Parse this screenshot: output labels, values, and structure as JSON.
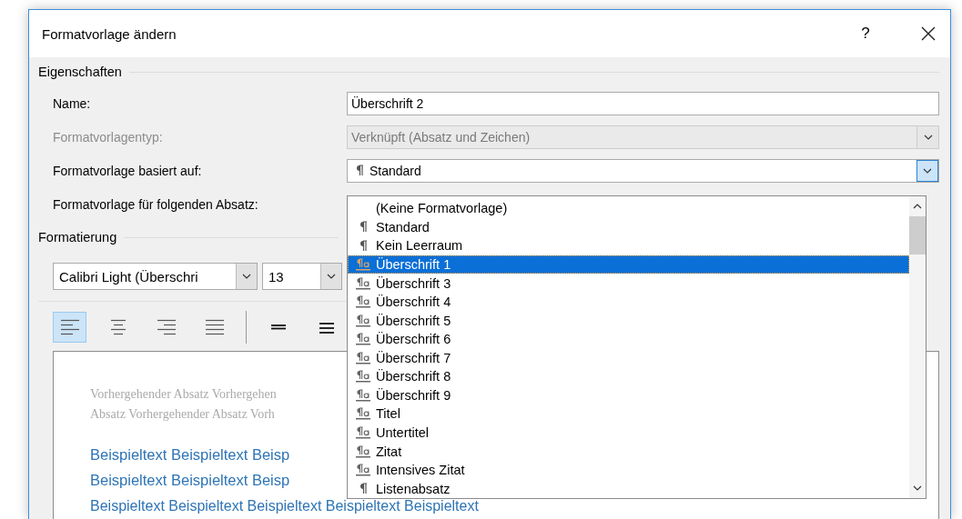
{
  "window": {
    "title": "Formatvorlage ändern",
    "help_button": "?"
  },
  "properties": {
    "heading": "Eigenschaften",
    "rows": [
      {
        "kind": "text",
        "label": "Name:",
        "value": "Überschrift 2",
        "disabled": false
      },
      {
        "kind": "combo",
        "label": "Formatvorlagentyp:",
        "value": "Verknüpft (Absatz und Zeichen)",
        "disabled": true,
        "expanded": false
      },
      {
        "kind": "style-combo",
        "label": "Formatvorlage basiert auf:",
        "value": "Standard",
        "disabled": false,
        "expanded": true
      },
      {
        "kind": "covered",
        "label": "Formatvorlage für folgenden Absatz:",
        "disabled": false
      }
    ]
  },
  "style_list": {
    "items": [
      {
        "kind": "none",
        "name": "(Keine Formatvorlage)",
        "selected": false
      },
      {
        "kind": "paragraph",
        "name": "Standard",
        "selected": false
      },
      {
        "kind": "paragraph",
        "name": "Kein Leerraum",
        "selected": false
      },
      {
        "kind": "linked",
        "name": "Überschrift 1",
        "selected": true
      },
      {
        "kind": "linked",
        "name": "Überschrift 3",
        "selected": false
      },
      {
        "kind": "linked",
        "name": "Überschrift 4",
        "selected": false
      },
      {
        "kind": "linked",
        "name": "Überschrift 5",
        "selected": false
      },
      {
        "kind": "linked",
        "name": "Überschrift 6",
        "selected": false
      },
      {
        "kind": "linked",
        "name": "Überschrift 7",
        "selected": false
      },
      {
        "kind": "linked",
        "name": "Überschrift 8",
        "selected": false
      },
      {
        "kind": "linked",
        "name": "Überschrift 9",
        "selected": false
      },
      {
        "kind": "linked",
        "name": "Titel",
        "selected": false
      },
      {
        "kind": "linked",
        "name": "Untertitel",
        "selected": false
      },
      {
        "kind": "linked",
        "name": "Zitat",
        "selected": false
      },
      {
        "kind": "linked",
        "name": "Intensives Zitat",
        "selected": false
      },
      {
        "kind": "paragraph",
        "name": "Listenabsatz",
        "selected": false
      }
    ]
  },
  "formatting": {
    "heading": "Formatierung",
    "font": "Calibri Light (Überschri",
    "size": "13",
    "alignment": [
      {
        "kind": "left",
        "selected": true
      },
      {
        "kind": "center",
        "selected": false
      },
      {
        "kind": "right",
        "selected": false
      },
      {
        "kind": "justify",
        "selected": false
      }
    ],
    "spacing": [
      {
        "kind": "single",
        "selected": false
      },
      {
        "kind": "one-half",
        "selected": false
      }
    ]
  },
  "preview": {
    "previous_lines": [
      "Vorhergehender Absatz Vorhergehen",
      "Absatz Vorhergehender Absatz Vorh"
    ],
    "sample_lines": [
      "Beispieltext Beispieltext Beisp",
      "Beispieltext Beispieltext Beisp",
      "Beispieltext Beispieltext Beispieltext Beispieltext Beispieltext"
    ]
  }
}
